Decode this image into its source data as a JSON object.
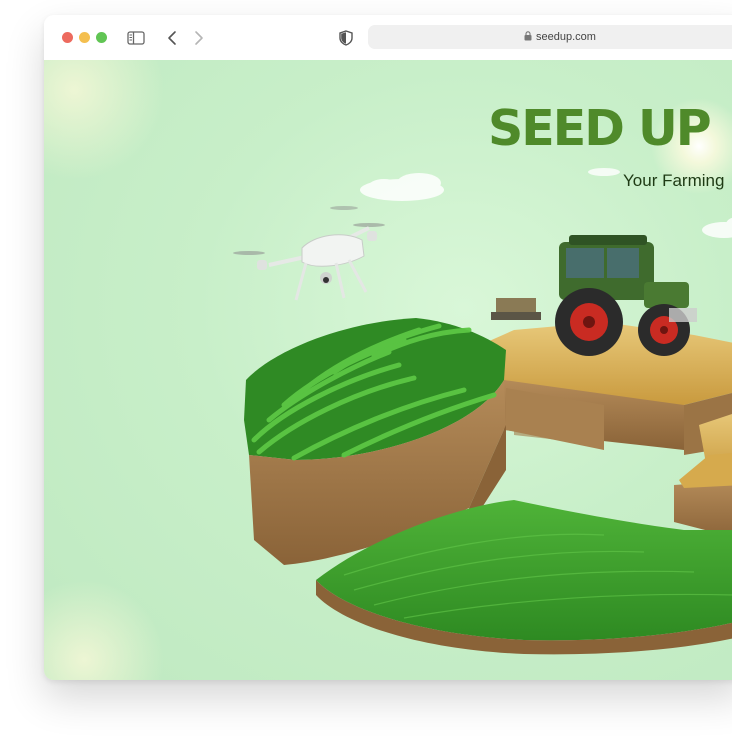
{
  "browser": {
    "url": "seedup.com",
    "icons": [
      "sidebar-toggle-icon",
      "back-arrow-icon",
      "forward-arrow-icon",
      "shield-icon",
      "lock-icon"
    ]
  },
  "hero": {
    "title": "SEED UP",
    "subtitle": "Your Farming"
  },
  "colors": {
    "title_green": "#4f8a2a",
    "background_green": "#c8efc9",
    "crop_green": "#3f9d2b",
    "wheat_gold": "#d9b25a",
    "soil_brown": "#a47d4f",
    "tractor_green": "#3f6b2d",
    "tractor_wheel_red": "#c92b22"
  }
}
